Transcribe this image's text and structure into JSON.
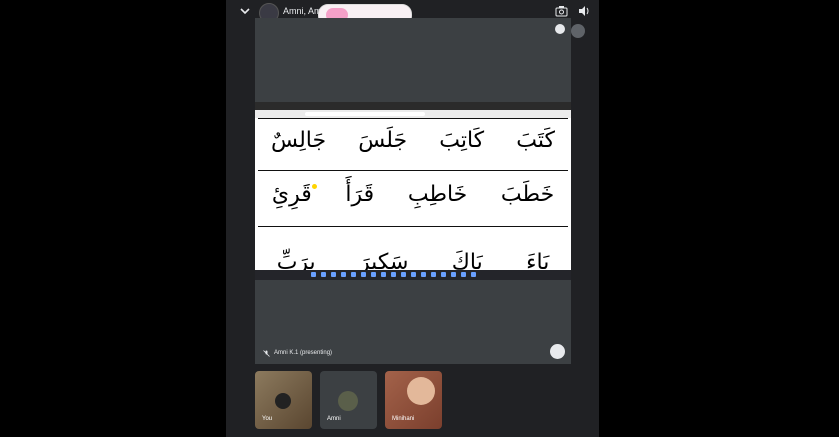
{
  "header": {
    "title": "Amni, Amni"
  },
  "presenter_label": "Amni K.1 (presenting)",
  "worksheet": {
    "row1": [
      "كَتَبَ",
      "كَاتِبَ",
      "جَلَسَ",
      "جَالِسٌ"
    ],
    "row2": [
      "خَطَبَ",
      "خَاطِبِ",
      "قَرَأَ",
      "قَرِئِ"
    ],
    "row3": [
      "بَاءَ",
      "بَاكَ",
      "سَكِيرَ",
      "بِرَبِّ"
    ]
  },
  "participants": [
    {
      "label": "You"
    },
    {
      "label": "Amni"
    },
    {
      "label": "Minihani"
    }
  ],
  "icons": [
    "chevron-down-icon",
    "camera-flip-icon",
    "speaker-icon",
    "pin-icon",
    "mic-off-icon",
    "fullscreen-icon"
  ]
}
